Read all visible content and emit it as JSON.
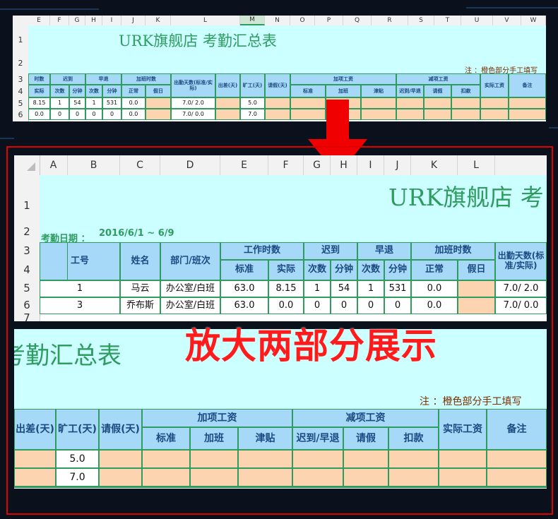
{
  "top": {
    "columns": [
      "E",
      "F",
      "G",
      "H",
      "I",
      "J",
      "K",
      "L",
      "M",
      "N",
      "O",
      "P",
      "Q",
      "R",
      "S",
      "T",
      "U",
      "V",
      "W"
    ],
    "rows": [
      "1",
      "2",
      "3",
      "4",
      "5",
      "6"
    ],
    "title": "URK旗舰店 考勤汇总表",
    "note": "注 ：橙色部分手工填写",
    "headers": {
      "e_top": "时数",
      "e_sub": "实际",
      "late": "迟到",
      "late_count": "次数",
      "late_min": "分钟",
      "early": "早退",
      "early_count": "次数",
      "early_min": "分钟",
      "ot": "加班时数",
      "ot_normal": "正常",
      "ot_holiday": "假日",
      "attend": "出勤天数(标准/实际)",
      "trip": "出差(天)",
      "absent": "旷工(天)",
      "leave": "请假(天)",
      "add_wage": "加项工资",
      "add_std": "标准",
      "add_ot": "加班",
      "add_allow": "津贴",
      "ded_wage": "减项工资",
      "ded_late": "迟到/早退",
      "ded_leave": "请假",
      "ded_fine": "扣款",
      "actual_wage": "实际工资",
      "remark": "备注"
    },
    "data_rows": [
      {
        "actual": "8.15",
        "late_c": "1",
        "late_m": "54",
        "early_c": "1",
        "early_m": "531",
        "ot_n": "0.0",
        "attend": "7.0/ 2.0",
        "absent": "5.0"
      },
      {
        "actual": "0.0",
        "late_c": "0",
        "late_m": "0",
        "early_c": "0",
        "early_m": "0",
        "ot_n": "0.0",
        "attend": "7.0/ 0.0",
        "absent": "7.0"
      }
    ]
  },
  "zoom1": {
    "columns": [
      "A",
      "B",
      "C",
      "D",
      "E",
      "F",
      "G",
      "H",
      "I",
      "J",
      "K",
      "L"
    ],
    "rows": [
      "1",
      "2",
      "3",
      "4",
      "5",
      "6",
      "7"
    ],
    "title": "URK旗舰店  考",
    "date_label": "考勤日期 ：",
    "date_range": "2016/6/1 ~ 6/9",
    "headers": {
      "emp_no": "工号",
      "name": "姓名",
      "dept": "部门/班次",
      "work_hours": "工作时数",
      "std": "标准",
      "actual": "实际",
      "late": "迟到",
      "late_count": "次数",
      "late_min": "分钟",
      "early": "早退",
      "early_count": "次数",
      "early_min": "分钟",
      "ot": "加班时数",
      "ot_normal": "正常",
      "ot_holiday": "假日",
      "attend": "出勤天数(标准/实际)"
    },
    "data_rows": [
      {
        "no": "1",
        "name": "马云",
        "dept": "办公室/白班",
        "std": "63.0",
        "actual": "8.15",
        "late_c": "1",
        "late_m": "54",
        "early_c": "1",
        "early_m": "531",
        "ot_n": "0.0",
        "attend": "7.0/ 2.0"
      },
      {
        "no": "3",
        "name": "乔布斯",
        "dept": "办公室/白班",
        "std": "63.0",
        "actual": "0.0",
        "late_c": "0",
        "late_m": "0",
        "early_c": "0",
        "early_m": "0",
        "ot_n": "0.0",
        "attend": "7.0/ 0.0"
      }
    ]
  },
  "zoom2": {
    "title": "考勤汇总表",
    "note": "注 ：橙色部分手工填写",
    "headers": {
      "trip": "出差(天)",
      "absent": "旷工(天)",
      "leave": "请假(天)",
      "add_wage": "加项工资",
      "add_std": "标准",
      "add_ot": "加班",
      "add_allow": "津贴",
      "ded_wage": "减项工资",
      "ded_late": "迟到/早退",
      "ded_leave": "请假",
      "ded_fine": "扣款",
      "actual_wage": "实际工资",
      "remark": "备注"
    },
    "absent_values": [
      "5.0",
      "7.0"
    ]
  },
  "overlay_caption": "放大两部分展示",
  "colors": {
    "title_band": "#ccffff",
    "header_blue": "#a6d8f8",
    "input_orange": "#fcd5b0",
    "green_text": "#2e9c5f",
    "grid_green": "#2e9c5f",
    "frame_red": "#e00000"
  }
}
